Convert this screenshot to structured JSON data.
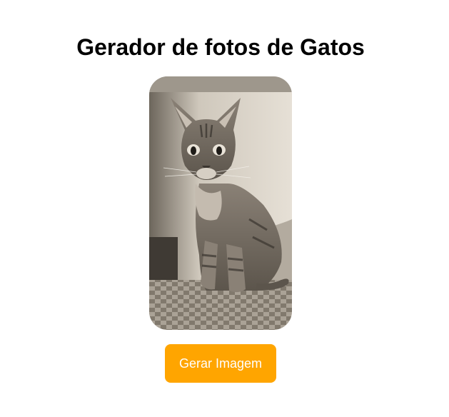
{
  "page": {
    "title": "Gerador de fotos de Gatos"
  },
  "image": {
    "alt": "cat photo",
    "subject": "sepia-toned photo of a tabby kitten sitting on a checkered surface"
  },
  "button": {
    "label": "Gerar Imagem"
  },
  "colors": {
    "button_bg": "#ffa500",
    "button_text": "#ffffff",
    "title_text": "#000000",
    "background": "#ffffff"
  }
}
